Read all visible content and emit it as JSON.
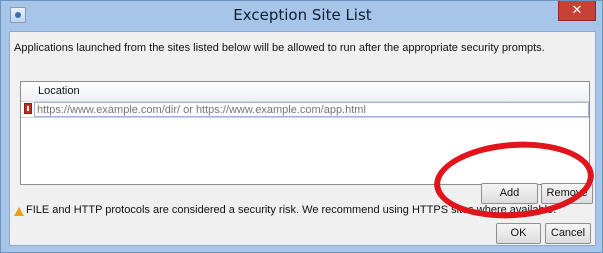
{
  "window": {
    "title": "Exception Site List",
    "close_glyph": "✕"
  },
  "description": "Applications launched from the sites listed below will be allowed to run after the appropriate security prompts.",
  "table": {
    "column_header": "Location",
    "rows": [
      {
        "placeholder": "https://www.example.com/dir/ or https://www.example.com/app.html"
      }
    ]
  },
  "buttons": {
    "add": "Add",
    "remove": "Remove",
    "ok": "OK",
    "cancel": "Cancel"
  },
  "warning": "FILE and HTTP protocols are considered a security risk.  We recommend using HTTPS sites where available.",
  "icons": {
    "app": "java-app-icon",
    "row_marker": "error-marker-icon",
    "warning": "warning-icon"
  },
  "colors": {
    "frame": "#a7c5e8",
    "close": "#c74236",
    "annotation": "#e0141a"
  }
}
